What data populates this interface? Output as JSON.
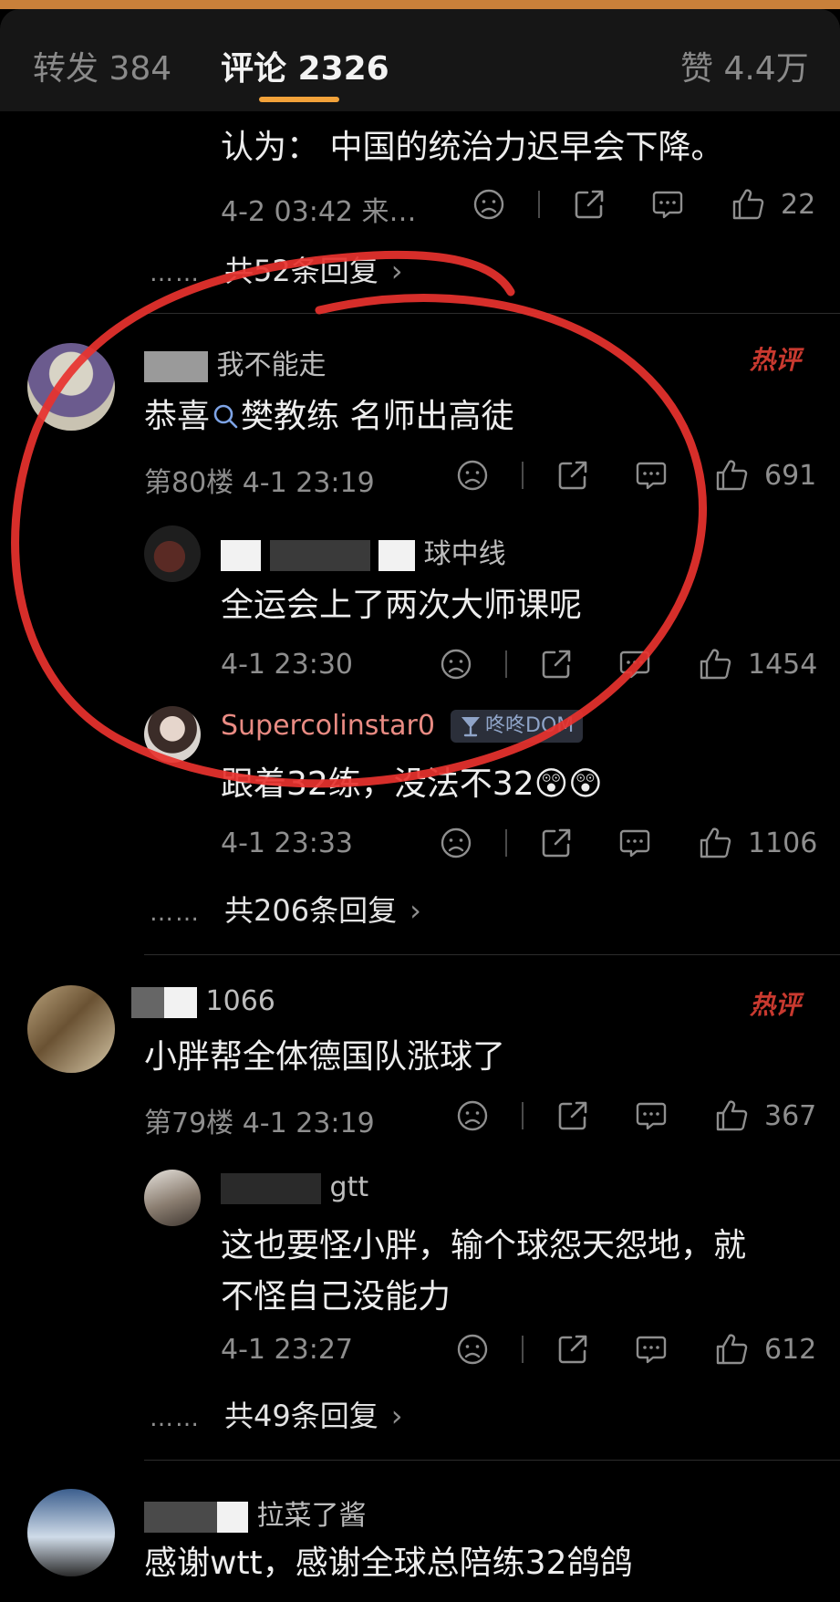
{
  "tabs": {
    "repost": "转发 384",
    "comments": "评论 2326",
    "likes": "赞 4.4万"
  },
  "colors": {
    "accent": "#f2a23a",
    "hot": "#c8392f",
    "username_vip": "#e98b83",
    "annotation_circle": "#e8322e"
  },
  "comments": [
    {
      "text": "认为： 中国的统治力迟早会下降。",
      "meta": "4-2 03:42 来…",
      "like_count": "22",
      "more_replies": "共52条回复"
    },
    {
      "username": "我不能走",
      "hot_label": "热评",
      "search_chip": "樊教练",
      "text_prefix": "恭喜",
      "text_suffix": " 名师出高徒",
      "meta": "第80楼 4-1 23:19",
      "like_count": "691",
      "replies": [
        {
          "username": "球中线",
          "text": "全运会上了两次大师课呢",
          "meta": "4-1 23:30",
          "like_count": "1454"
        },
        {
          "username": "Supercolinstar0",
          "badge": "咚咚DOM",
          "text": "跟着32练，没法不32",
          "meta": "4-1 23:33",
          "like_count": "1106"
        }
      ],
      "more_replies": "共206条回复"
    },
    {
      "username": "1066",
      "hot_label": "热评",
      "text": "小胖帮全体德国队涨球了",
      "meta": "第79楼 4-1 23:19",
      "like_count": "367",
      "replies": [
        {
          "username": "gtt",
          "text_line1": "这也要怪小胖，输个球怨天怨地，就",
          "text_line2": "不怪自己没能力",
          "meta": "4-1 23:27",
          "like_count": "612"
        }
      ],
      "more_replies": "共49条回复"
    },
    {
      "username": "拉菜了酱",
      "text": "感谢wtt，感谢全球总陪练32鸽鸽"
    }
  ],
  "icons": [
    "sad-face-icon",
    "share-icon",
    "comment-icon",
    "thumbs-up-icon",
    "search-icon",
    "chevron-right-icon",
    "medal-icon"
  ]
}
